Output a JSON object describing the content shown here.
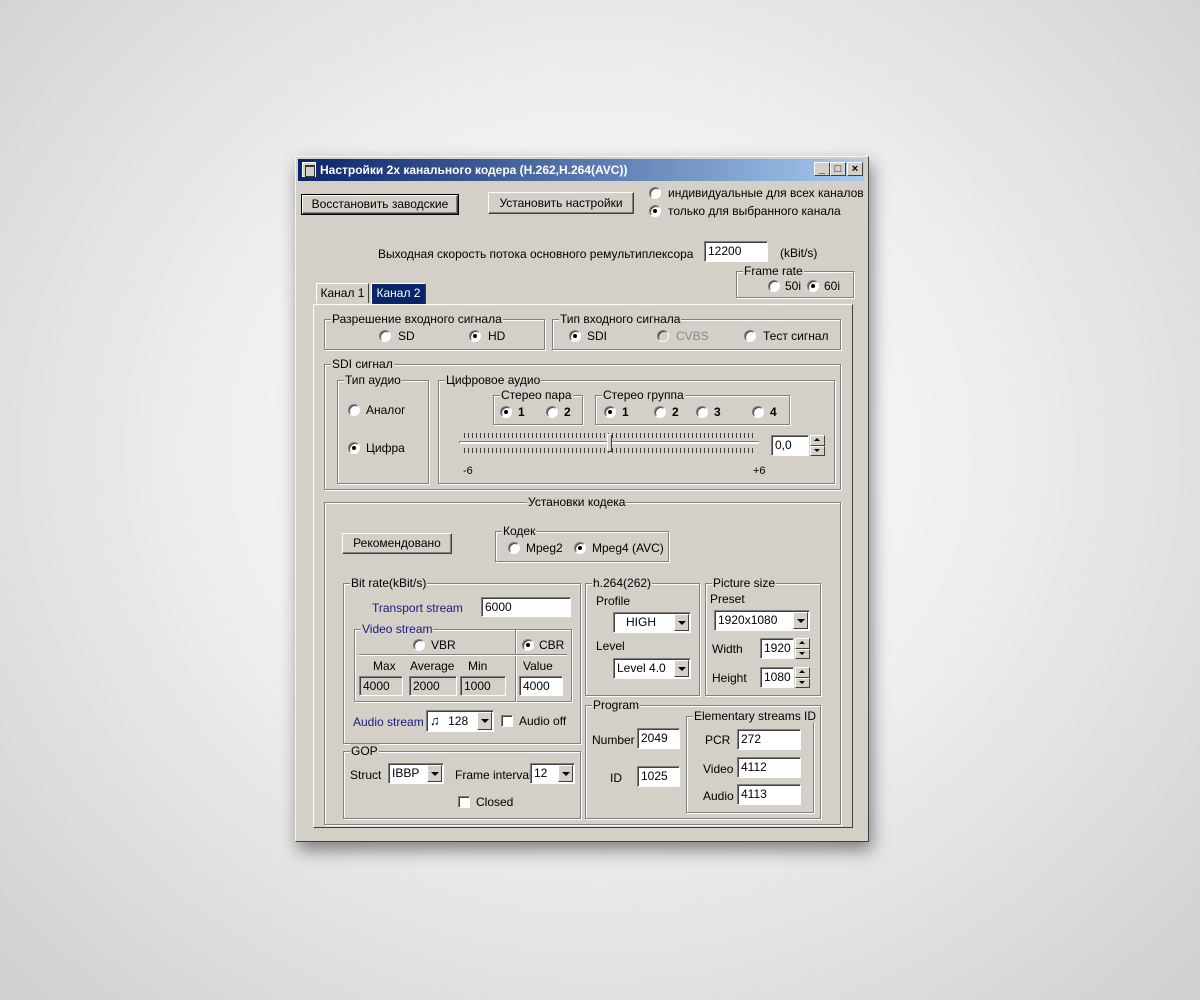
{
  "window": {
    "title": "Настройки 2х канального  кодера (H.262,H.264(AVC))",
    "controls": {
      "minimize": "_",
      "maximize": "□",
      "close": "×"
    }
  },
  "top": {
    "restore_button": "Восстановить заводские",
    "apply_button": "Установить настройки",
    "apply_scope": {
      "option_all": "индивидуальные для всех каналов",
      "option_selected": "только для выбранного канала",
      "selected": "option_selected"
    },
    "output_rate_label": "Выходная скорость потока  основного ремультиплексора",
    "output_rate_value": "12200",
    "output_rate_unit": "(kBit/s)",
    "frame_rate": {
      "legend": "Frame rate",
      "opt_50i": "50i",
      "opt_60i": "60i",
      "selected": "60i"
    }
  },
  "tabs": [
    {
      "label": "Канал 1",
      "selected": false
    },
    {
      "label": "Канал 2",
      "selected": true
    }
  ],
  "input_resolution": {
    "legend": "Разрешение входного сигнала",
    "sd": "SD",
    "hd": "HD",
    "selected": "HD"
  },
  "input_type": {
    "legend": "Тип входного сигнала",
    "sdi": "SDI",
    "cvbs": "CVBS",
    "test": "Тест сигнал",
    "selected": "SDI"
  },
  "sdi": {
    "legend": "SDI сигнал",
    "audio_type": {
      "legend": "Тип аудио",
      "analog": "Аналог",
      "digital": "Цифра",
      "selected": "Цифра"
    },
    "digital_audio": {
      "legend": "Цифровое аудио",
      "stereo_pair": {
        "legend": "Стерео пара",
        "options": [
          "1",
          "2"
        ],
        "selected": "1"
      },
      "stereo_group": {
        "legend": "Стерео группа",
        "options": [
          "1",
          "2",
          "3",
          "4"
        ],
        "selected": "1"
      },
      "level": {
        "min_label": "-6",
        "max_label": "+6",
        "value": "0,0",
        "level_fraction": 0.5
      }
    }
  },
  "codec_settings": {
    "legend": "Установки кодека",
    "recommended_button": "Рекомендовано",
    "codec": {
      "legend": "Кодек",
      "mpeg2": "Mpeg2",
      "mpeg4": "Mpeg4 (AVC)",
      "selected": "Mpeg4 (AVC)"
    },
    "bitrate": {
      "legend": "Bit rate(kBit/s)",
      "transport_label": "Transport stream",
      "transport_value": "6000",
      "video": {
        "legend": "Video stream",
        "vbr": "VBR",
        "cbr": "CBR",
        "selected": "CBR",
        "max_label": "Max",
        "avg_label": "Average",
        "min_label": "Min",
        "value_label": "Value",
        "max": "4000",
        "avg": "2000",
        "min": "1000",
        "value": "4000"
      },
      "audio_label": "Audio stream",
      "audio_value": "128",
      "audio_icon": "music-note-icon",
      "audio_off_label": "Audio off",
      "audio_off_checked": false
    },
    "gop": {
      "legend": "GOP",
      "struct_label": "Struct",
      "struct_value": "IBBP",
      "interval_label": "Frame interval",
      "interval_value": "12",
      "closed_label": "Closed",
      "closed_checked": false
    },
    "h264": {
      "legend": "h.264(262)",
      "profile_label": "Profile",
      "profile_value": "HIGH",
      "level_label": "Level",
      "level_value": "Level 4.0"
    },
    "picture": {
      "legend": "Picture size",
      "preset_label": "Preset",
      "preset_value": "1920x1080",
      "width_label": "Width",
      "width_value": "1920",
      "height_label": "Height",
      "height_value": "1080"
    },
    "program": {
      "legend": "Program",
      "number_label": "Number",
      "number_value": "2049",
      "id_label": "ID",
      "id_value": "1025"
    },
    "es_ids": {
      "legend": "Elementary streams ID",
      "pcr_label": "PCR",
      "pcr_value": "272",
      "video_label": "Video",
      "video_value": "4112",
      "audio_label": "Audio",
      "audio_value": "4113"
    }
  }
}
